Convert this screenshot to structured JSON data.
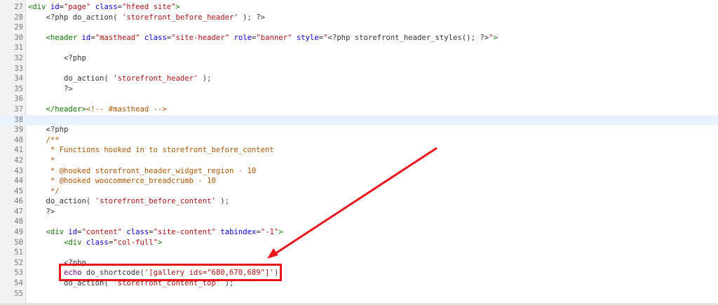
{
  "editor": {
    "lines": [
      {
        "n": "27",
        "segs": [
          [
            "tag",
            "<div "
          ],
          [
            "attr",
            "id"
          ],
          [
            "plain",
            "="
          ],
          [
            "str",
            "\"page\""
          ],
          [
            "plain",
            " "
          ],
          [
            "attr",
            "class"
          ],
          [
            "plain",
            "="
          ],
          [
            "str",
            "\"hfeed site\""
          ],
          [
            "tag",
            ">"
          ]
        ]
      },
      {
        "n": "28",
        "segs": [
          [
            "plain",
            "    <?php do_action( "
          ],
          [
            "sq",
            "'storefront_before_header'"
          ],
          [
            "plain",
            " ); ?>"
          ]
        ]
      },
      {
        "n": "29",
        "segs": []
      },
      {
        "n": "30",
        "segs": [
          [
            "plain",
            "    "
          ],
          [
            "tag",
            "<header "
          ],
          [
            "attr",
            "id"
          ],
          [
            "plain",
            "="
          ],
          [
            "str",
            "\"masthead\""
          ],
          [
            "plain",
            " "
          ],
          [
            "attr",
            "class"
          ],
          [
            "plain",
            "="
          ],
          [
            "str",
            "\"site-header\""
          ],
          [
            "plain",
            " "
          ],
          [
            "attr",
            "role"
          ],
          [
            "plain",
            "="
          ],
          [
            "str",
            "\"banner\""
          ],
          [
            "plain",
            " "
          ],
          [
            "attr",
            "style"
          ],
          [
            "plain",
            "="
          ],
          [
            "str",
            "\""
          ],
          [
            "plain",
            "<?php storefront_header_styles(); ?>"
          ],
          [
            "str",
            "\""
          ],
          [
            "tag",
            ">"
          ]
        ]
      },
      {
        "n": "31",
        "segs": []
      },
      {
        "n": "32",
        "segs": [
          [
            "plain",
            "        <?php"
          ]
        ]
      },
      {
        "n": "33",
        "segs": []
      },
      {
        "n": "34",
        "segs": [
          [
            "plain",
            "        do_action( "
          ],
          [
            "sq",
            "'storefront_header'"
          ],
          [
            "plain",
            " );"
          ]
        ]
      },
      {
        "n": "35",
        "segs": [
          [
            "plain",
            "        ?>"
          ]
        ]
      },
      {
        "n": "36",
        "segs": []
      },
      {
        "n": "37",
        "segs": [
          [
            "plain",
            "    "
          ],
          [
            "tag",
            "</header>"
          ],
          [
            "cm",
            "<!-- #masthead -->"
          ]
        ]
      },
      {
        "n": "38",
        "segs": [],
        "hl": true
      },
      {
        "n": "39",
        "segs": [
          [
            "plain",
            "    <?php"
          ]
        ]
      },
      {
        "n": "40",
        "segs": [
          [
            "plain",
            "    "
          ],
          [
            "cm",
            "/**"
          ]
        ]
      },
      {
        "n": "41",
        "segs": [
          [
            "cm",
            "     * Functions hooked in to storefront_before_content"
          ]
        ]
      },
      {
        "n": "42",
        "segs": [
          [
            "cm",
            "     *"
          ]
        ]
      },
      {
        "n": "43",
        "segs": [
          [
            "cm",
            "     * @hooked storefront_header_widget_region - 10"
          ]
        ]
      },
      {
        "n": "44",
        "segs": [
          [
            "cm",
            "     * @hooked woocommerce_breadcrumb - 10"
          ]
        ]
      },
      {
        "n": "45",
        "segs": [
          [
            "cm",
            "     */"
          ]
        ]
      },
      {
        "n": "46",
        "segs": [
          [
            "plain",
            "    do_action( "
          ],
          [
            "sq",
            "'storefront_before_content'"
          ],
          [
            "plain",
            " );"
          ]
        ]
      },
      {
        "n": "47",
        "segs": [
          [
            "plain",
            "    ?>"
          ]
        ]
      },
      {
        "n": "48",
        "segs": []
      },
      {
        "n": "49",
        "segs": [
          [
            "plain",
            "    "
          ],
          [
            "tag",
            "<div "
          ],
          [
            "attr",
            "id"
          ],
          [
            "plain",
            "="
          ],
          [
            "str",
            "\"content\""
          ],
          [
            "plain",
            " "
          ],
          [
            "attr",
            "class"
          ],
          [
            "plain",
            "="
          ],
          [
            "str",
            "\"site-content\""
          ],
          [
            "plain",
            " "
          ],
          [
            "attr",
            "tabindex"
          ],
          [
            "plain",
            "="
          ],
          [
            "str",
            "\"-1\""
          ],
          [
            "tag",
            ">"
          ]
        ]
      },
      {
        "n": "50",
        "segs": [
          [
            "plain",
            "        "
          ],
          [
            "tag",
            "<div "
          ],
          [
            "attr",
            "class"
          ],
          [
            "plain",
            "="
          ],
          [
            "str",
            "\"col-full\""
          ],
          [
            "tag",
            ">"
          ]
        ]
      },
      {
        "n": "51",
        "segs": []
      },
      {
        "n": "52",
        "segs": [
          [
            "plain",
            "        <?php"
          ]
        ]
      },
      {
        "n": "53",
        "segs": [
          [
            "plain",
            "        "
          ],
          [
            "kw",
            "echo"
          ],
          [
            "plain",
            " do_shortcode("
          ],
          [
            "sq",
            "'[gallery ids=\"680,670,689\"]'"
          ],
          [
            "plain",
            ");"
          ]
        ]
      },
      {
        "n": "54",
        "segs": [
          [
            "plain",
            "        do_action( "
          ],
          [
            "sq",
            "'storefront_content_top'"
          ],
          [
            "plain",
            " );"
          ]
        ]
      },
      {
        "n": "55",
        "segs": []
      }
    ]
  },
  "colors": {
    "annotation_red": "#e8151b",
    "line_highlight": "#e8f2fe"
  }
}
